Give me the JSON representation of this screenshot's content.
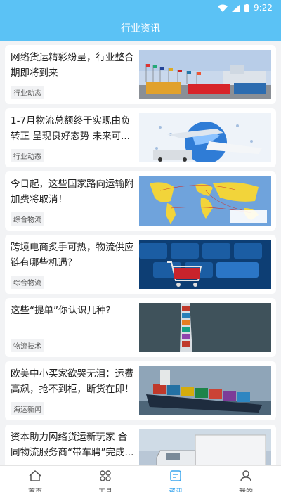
{
  "status": {
    "time": "9:22"
  },
  "header": {
    "title": "行业资讯"
  },
  "articles": [
    {
      "title": "网络货运精彩纷呈，行业整合期即将到来",
      "tag": "行业动态",
      "image": "port-flags"
    },
    {
      "title": "1-7月物流总额终于实现由负转正 呈现良好态势 未来可...",
      "tag": "行业动态",
      "image": "globe-transport"
    },
    {
      "title": "今日起，这些国家路向运输附加费将取消！",
      "tag": "综合物流",
      "image": "world-map"
    },
    {
      "title": "跨境电商炙手可热，物流供应链有哪些机遇？",
      "tag": "综合物流",
      "image": "keyboard-cart"
    },
    {
      "title": "这些“提单”你认识几种?",
      "tag": "物流技术",
      "image": "container-ship-aerial"
    },
    {
      "title": "欧美中小买家欲哭无泪：运费高飙，抢不到柜，断货在即！",
      "tag": "海运新闻",
      "image": "cargo-ship"
    },
    {
      "title": "资本助力网络货运新玩家 合同物流服务商“带车聘”完成...",
      "tag": "",
      "image": "truck"
    }
  ],
  "tabbar": {
    "items": [
      {
        "label": "首页",
        "icon": "home-icon",
        "active": false
      },
      {
        "label": "工具",
        "icon": "grid-icon",
        "active": false
      },
      {
        "label": "资讯",
        "icon": "news-icon",
        "active": true
      },
      {
        "label": "我的",
        "icon": "user-icon",
        "active": false
      }
    ]
  },
  "colors": {
    "header": "#5bc2f5",
    "active_tab": "#3aa6ee"
  }
}
